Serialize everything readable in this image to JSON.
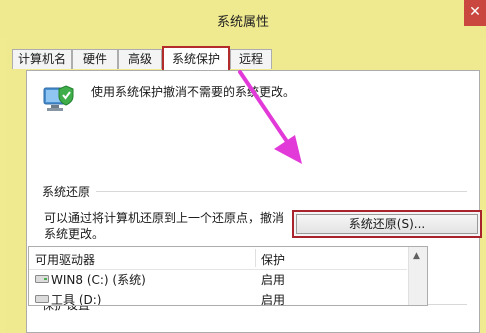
{
  "window": {
    "title": "系统属性",
    "close_label": "✕"
  },
  "tabs": [
    {
      "label": "计算机名",
      "active": false
    },
    {
      "label": "硬件",
      "active": false
    },
    {
      "label": "高级",
      "active": false
    },
    {
      "label": "系统保护",
      "active": true
    },
    {
      "label": "远程",
      "active": false
    }
  ],
  "protection": {
    "description": "使用系统保护撤消不需要的系统更改。",
    "icon": "computer-shield-icon"
  },
  "restore": {
    "section_title": "系统还原",
    "description": "可以通过将计算机还原到上一个还原点，撤消系统更改。",
    "button_label": "系统还原(S)..."
  },
  "settings": {
    "section_title": "保护设置",
    "columns": [
      "可用驱动器",
      "保护"
    ],
    "rows": [
      {
        "drive": "WIN8 (C:) (系统)",
        "protection": "启用"
      },
      {
        "drive": "工具 (D:)",
        "protection": "启用"
      }
    ]
  },
  "colors": {
    "highlight": "#b32b2b",
    "annotation_arrow": "#e23ad9"
  }
}
